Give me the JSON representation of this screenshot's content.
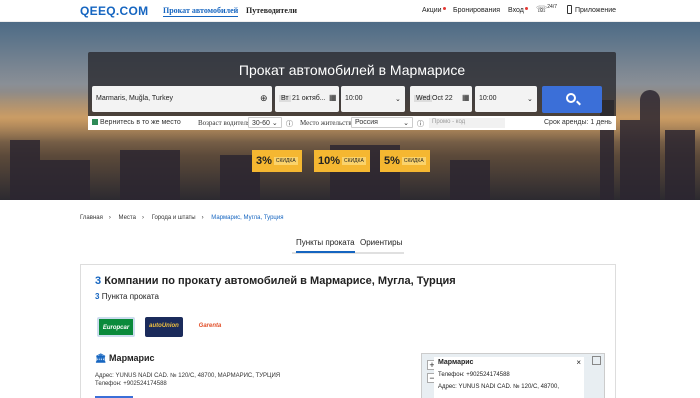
{
  "header": {
    "logo": "QEEQ.COM",
    "nav": [
      "Прокат автомобилей",
      "Путеводители"
    ],
    "right": {
      "promos": "Акции",
      "bookings": "Бронирования",
      "login": "Вход",
      "support": "24/7",
      "app": "Приложение"
    }
  },
  "hero": {
    "title": "Прокат автомобилей в Мармарисе",
    "location": "Marmaris, Muğla, Turkey",
    "pickup_day": "Вт",
    "pickup_date": "21 октяб...",
    "pickup_time": "10:00",
    "return_day": "Wed",
    "return_date": "Oct 22",
    "return_time": "10:00",
    "return_same": "Вернитесь в то же место",
    "driver_age_label": "Возраст водителя:",
    "driver_age": "30-60",
    "residence_label": "Место жительства:",
    "residence": "Россия",
    "promo_placeholder": "Промо - код",
    "duration": "Срок аренды: 1 день",
    "discounts": [
      {
        "value": "3%",
        "label": "СКИДКА"
      },
      {
        "value": "10%",
        "label": "СКИДКА"
      },
      {
        "value": "5%",
        "label": "СКИДКА"
      }
    ]
  },
  "breadcrumbs": [
    "Главная",
    "Места",
    "Города и штаты",
    "Мармарис, Мугла, Турция"
  ],
  "tabs": [
    "Пункты проката",
    "Ориентиры"
  ],
  "companies": {
    "count": "3",
    "title": "Компании по прокату автомобилей в Мармарисе, Мугла, Турция",
    "points_count": "3",
    "points_label": "Пункта проката",
    "brands": [
      "Europcar",
      "autoUnion",
      "Garenta"
    ]
  },
  "office": {
    "name": "Мармарис",
    "address": "Адрес: YUNUS NADI CAD. № 120/C, 48700, МАРМАРИС, ТУРЦИЯ",
    "phone": "Телефон: +902524174588"
  },
  "map": {
    "popup_name": "Мармарис",
    "popup_phone": "Телефон: +902524174588",
    "popup_address": "Адрес: YUNUS NADI CAD. № 120/C, 48700,",
    "zoom_in": "+",
    "zoom_out": "−",
    "close": "×"
  }
}
